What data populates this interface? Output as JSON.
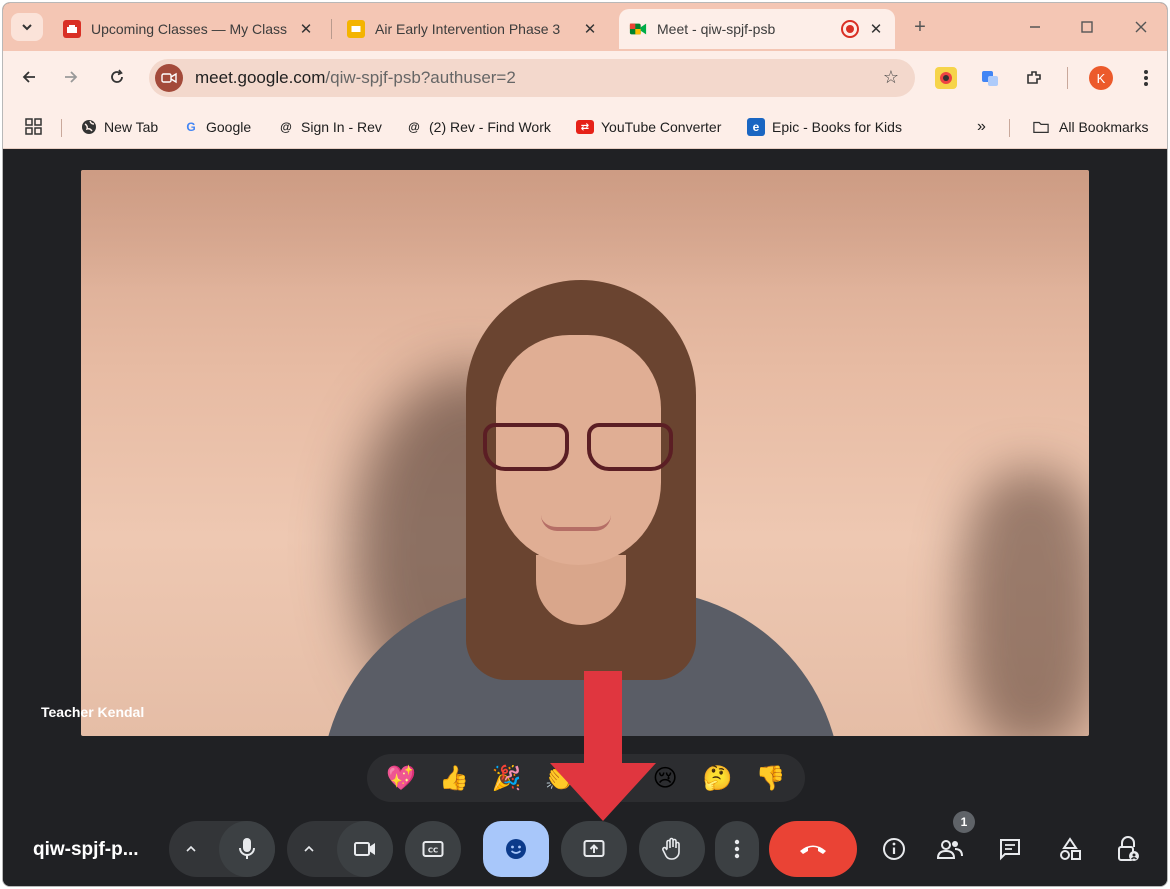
{
  "browser": {
    "tabs": [
      {
        "title": "Upcoming Classes — My Class",
        "active": false,
        "favicon_color": "#d93025"
      },
      {
        "title": "Air Early Intervention Phase 3",
        "active": false,
        "favicon_color": "#f4b400"
      },
      {
        "title": "Meet - qiw-spjf-psb",
        "active": true,
        "favicon_color": "#00897b"
      }
    ],
    "close_glyph": "✕",
    "new_tab_glyph": "+",
    "url_host": "meet.google.com",
    "url_path": "/qiw-spjf-psb?authuser=2",
    "profile_initial": "K",
    "bookmarks": [
      {
        "label": "New Tab",
        "icon": "globe-icon"
      },
      {
        "label": "Google",
        "icon": "google-icon",
        "glyph": "G",
        "color": "#4285f4"
      },
      {
        "label": "Sign In - Rev",
        "icon": "rev-icon",
        "glyph": "@",
        "color": "#222222"
      },
      {
        "label": "(2) Rev - Find Work",
        "icon": "rev-icon",
        "glyph": "@",
        "color": "#222222"
      },
      {
        "label": "YouTube Converter",
        "icon": "youtube-converter-icon",
        "glyph": "⇄",
        "color": "#e62117"
      },
      {
        "label": "Epic - Books for Kids",
        "icon": "epic-icon",
        "glyph": "e",
        "color": "#1a66c2"
      }
    ],
    "overflow_label": "»",
    "all_bookmarks_label": "All Bookmarks"
  },
  "meet": {
    "participant_name": "Teacher Kendal",
    "meeting_code": "qiw-spjf-p...",
    "participant_count": "1",
    "reactions": [
      "💖",
      "👍",
      "🎉",
      "👏",
      "😮",
      "😢",
      "🤔",
      "👎"
    ],
    "colors": {
      "background": "#202124",
      "button": "#3c4043",
      "active_button": "#a8c7fa",
      "end_call": "#ea4335",
      "arrow": "#e0363f"
    }
  }
}
